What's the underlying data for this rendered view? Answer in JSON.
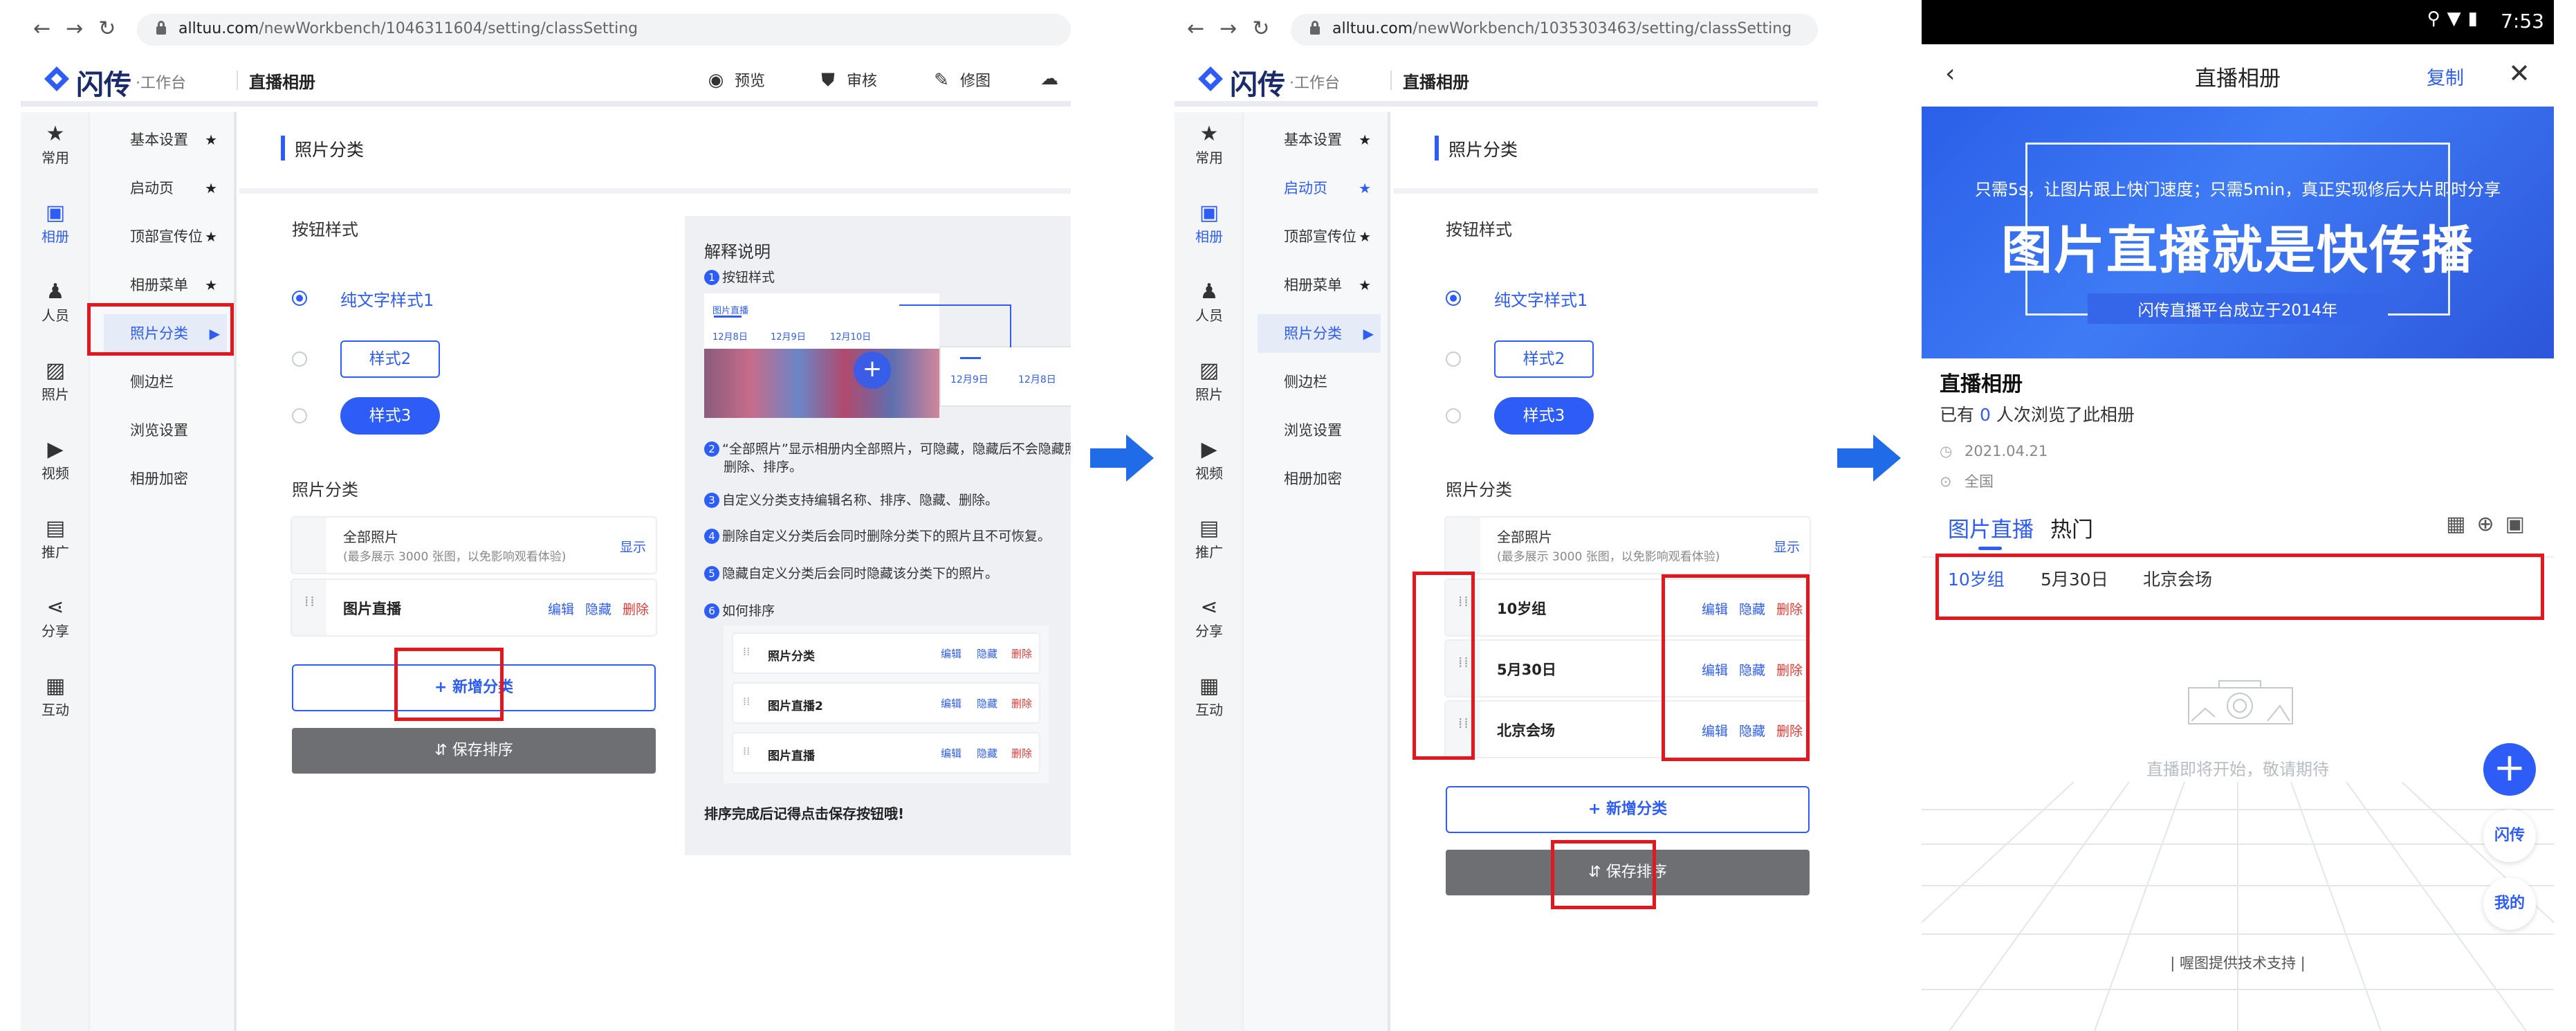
{
  "left": {
    "url_domain": "alltuu.com",
    "url_path": "/newWorkbench/1046311604/setting/classSetting"
  },
  "middle": {
    "url_domain": "alltuu.com",
    "url_path": "/newWorkbench/1035303463/setting/classSetting"
  },
  "app": {
    "logo": "闪传",
    "logo_sub": "·工作台",
    "title": "直播相册",
    "actions": {
      "preview": "预览",
      "review": "审核",
      "retouch": "修图"
    }
  },
  "rail": [
    {
      "icon": "star-icon",
      "label": "常用"
    },
    {
      "icon": "album-icon",
      "label": "相册"
    },
    {
      "icon": "person-icon",
      "label": "人员"
    },
    {
      "icon": "photo-icon",
      "label": "照片"
    },
    {
      "icon": "video-icon",
      "label": "视频"
    },
    {
      "icon": "promote-icon",
      "label": "推广"
    },
    {
      "icon": "share-icon",
      "label": "分享"
    },
    {
      "icon": "chat-icon",
      "label": "互动"
    }
  ],
  "subnav": [
    "基本设置",
    "启动页",
    "顶部宣传位",
    "相册菜单",
    "照片分类",
    "侧边栏",
    "浏览设置",
    "相册加密"
  ],
  "page": {
    "title": "照片分类",
    "button_style": "按钮样式",
    "style1": "纯文字样式1",
    "style2": "样式2",
    "style3": "样式3",
    "category_title": "照片分类",
    "all_photos": "全部照片",
    "all_hint": "(最多展示 3000 张图，以免影响观看体验)",
    "show": "显示",
    "edit": "编辑",
    "hide": "隐藏",
    "delete": "删除",
    "add": "+ 新增分类",
    "save": "⇵ 保存排序"
  },
  "left_rows": [
    "图片直播"
  ],
  "middle_rows": [
    "10岁组",
    "5月30日",
    "北京会场"
  ],
  "explain": {
    "title": "解释说明",
    "l1": "按钮样式",
    "l2a": "“全部照片”显示相册内全部照片，可隐藏，隐藏后不会隐藏照片",
    "l2b": "删除、排序。",
    "l3": "自定义分类支持编辑名称、排序、隐藏、删除。",
    "l4": "删除自定义分类后会同时删除分类下的照片且不可恢复。",
    "l5": "隐藏自定义分类后会同时隐藏该分类下的照片。",
    "l6": "如何排序",
    "sort_rows": [
      "照片分类",
      "图片直播2",
      "图片直播"
    ],
    "footer": "排序完成后记得点击保存按钮哦!",
    "mini_tab": "图片直播",
    "mini_d1": "12月8日",
    "mini_d2": "12月9日",
    "mini_d3": "12月10日",
    "mini_d4": "12月9日",
    "mini_d5": "12月8日",
    "nums": [
      "1",
      "2",
      "3",
      "4",
      "5",
      "6"
    ]
  },
  "phone": {
    "time": "7:53",
    "title": "直播相册",
    "copy": "复制",
    "banner_sub1": "只需5s，让图片跟上快门速度；只需5min，真正实现修后大片即时分享",
    "banner_big": "图片直播就是快传播",
    "banner_sub2": "闪传直播平台成立于2014年",
    "album_title": "直播相册",
    "views_prefix": "已有",
    "views_count": "0",
    "views_suffix": "人次浏览了此相册",
    "date": "2021.04.21",
    "location": "全国",
    "tab1": "图片直播",
    "tab2": "热门",
    "cats": [
      "10岁组",
      "5月30日",
      "北京会场"
    ],
    "empty": "直播即将开始，敬请期待",
    "btn_shan": "闪传",
    "btn_mine": "我的",
    "footer": "|  喔图提供技术支持  |"
  },
  "colors": {
    "accent": "#2d5df6",
    "highlight": "#e3171d",
    "save_bg": "#6e6f73"
  }
}
